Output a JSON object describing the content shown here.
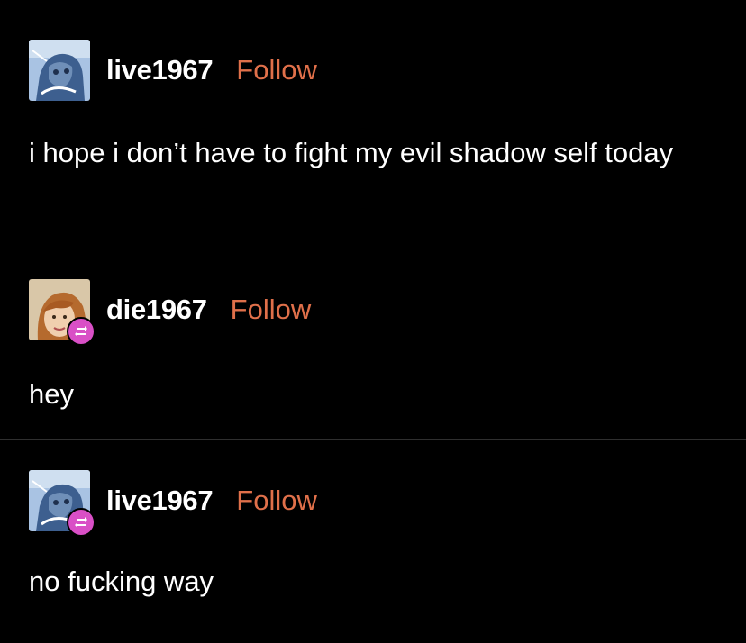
{
  "posts": [
    {
      "username": "live1967",
      "follow_label": "Follow",
      "avatar_icon": "blue-sketch-avatar-icon",
      "reblogged": false,
      "text": "i hope i don’t have to fight my evil shadow self today"
    },
    {
      "username": "die1967",
      "follow_label": "Follow",
      "avatar_icon": "ginger-person-avatar-icon",
      "reblogged": true,
      "text": "hey"
    },
    {
      "username": "live1967",
      "follow_label": "Follow",
      "avatar_icon": "blue-sketch-avatar-icon",
      "reblogged": true,
      "text": "no fucking way"
    }
  ],
  "colors": {
    "background": "#000000",
    "text": "#ffffff",
    "follow": "#e0704a",
    "reblog_badge": "#d94fc6",
    "divider": "#2f2f2f"
  }
}
